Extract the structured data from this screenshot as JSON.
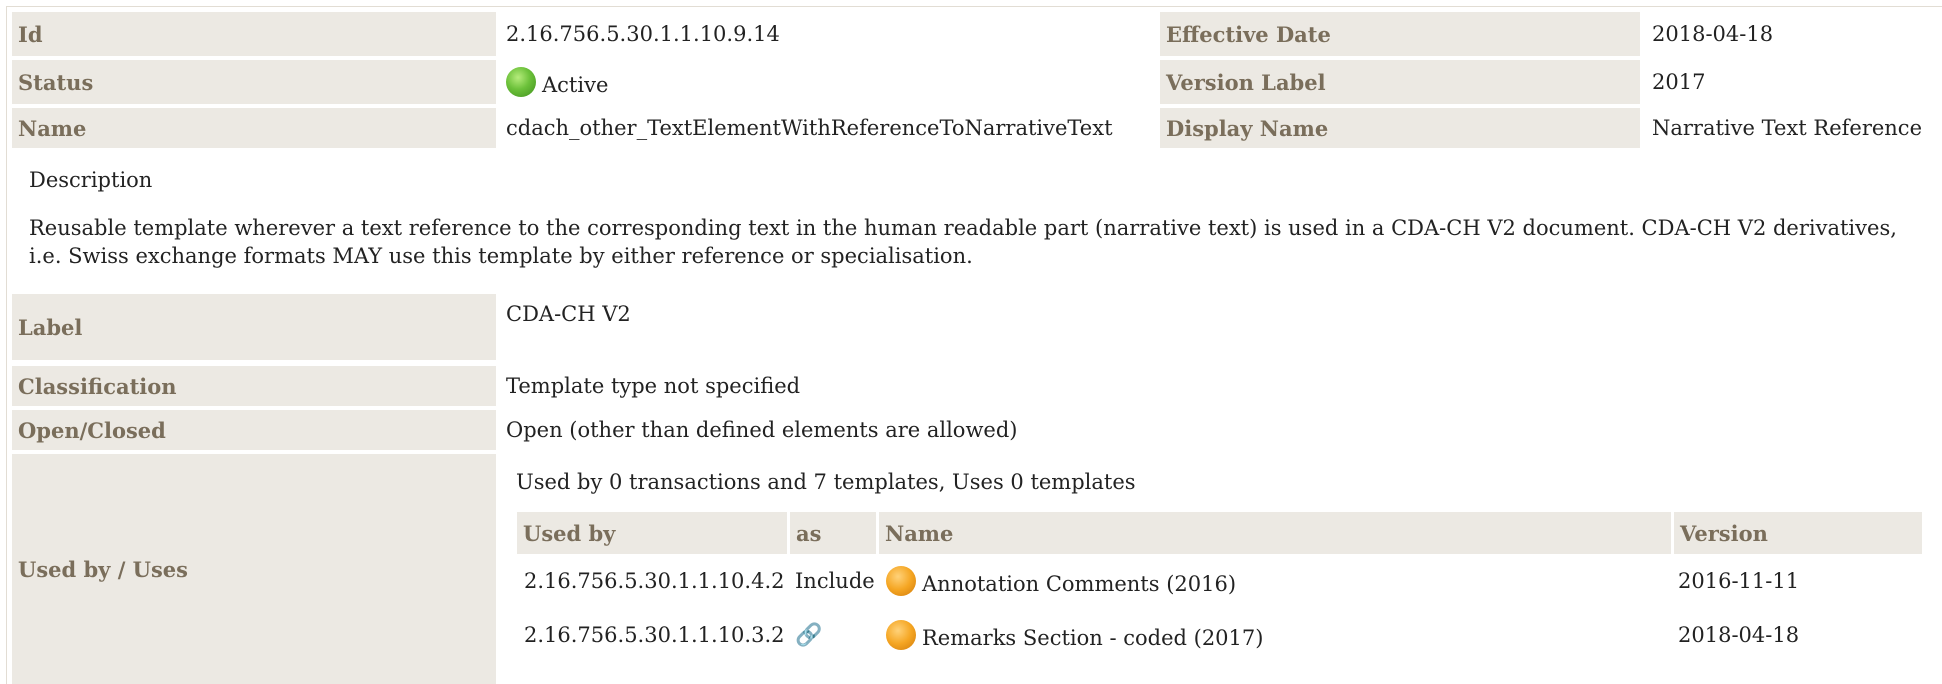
{
  "rows": {
    "id": {
      "label": "Id",
      "value": "2.16.756.5.30.1.1.10.9.14"
    },
    "effective_date": {
      "label": "Effective Date",
      "value": "2018-04-18"
    },
    "status": {
      "label": "Status",
      "value": "Active"
    },
    "version_label": {
      "label": "Version Label",
      "value": "2017"
    },
    "name": {
      "label": "Name",
      "value": "cdach_other_TextElementWithReferenceToNarrativeText"
    },
    "display_name": {
      "label": "Display Name",
      "value": "Narrative Text Reference"
    }
  },
  "description": {
    "heading": "Description",
    "text": "Reusable template wherever a text reference to the corresponding text in the human readable part (narrative text) is used in a CDA-CH V2 document. CDA-CH V2 derivatives, i.e. Swiss exchange formats MAY use this template by either reference or specialisation."
  },
  "details": {
    "label": {
      "label": "Label",
      "value": "CDA-CH V2"
    },
    "classification": {
      "label": "Classification",
      "value": "Template type not specified"
    },
    "open_closed": {
      "label": "Open/Closed",
      "value": "Open (other than defined elements are allowed)"
    },
    "used_by": {
      "label": "Used by / Uses",
      "summary": "Used by 0 transactions and 7 templates, Uses 0 templates"
    }
  },
  "used_by_table": {
    "headers": [
      "Used by",
      "as",
      "Name",
      "Version"
    ],
    "rows": [
      {
        "id": "2.16.756.5.30.1.1.10.4.2",
        "as": "Include",
        "as_icon": "",
        "name": "Annotation Comments (2016)",
        "version": "2016-11-11"
      },
      {
        "id": "2.16.756.5.30.1.1.10.3.2",
        "as": "",
        "as_icon": "link-icon",
        "name": "Remarks Section - coded (2017)",
        "version": "2018-04-18"
      }
    ]
  },
  "colors": {
    "label_bg": "#ece9e3",
    "label_text": "#7a6e5b",
    "status_active": "#6cc13a",
    "status_draft": "#f5a623"
  }
}
